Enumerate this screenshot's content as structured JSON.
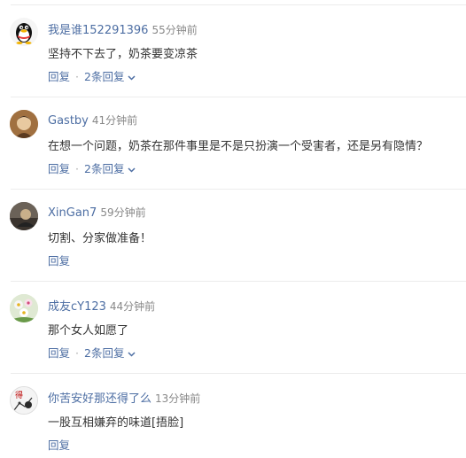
{
  "comments": [
    {
      "user": "我是谁152291396",
      "time": "55分钟前",
      "text": "坚持不下去了，奶茶要变凉茶",
      "reply_label": "回复",
      "replies_label": "2条回复",
      "avatar": "qq-penguin-icon"
    },
    {
      "user": "Gastby",
      "time": "41分钟前",
      "text": "在想一个问题，奶茶在那件事里是不是只扮演一个受害者，还是另有隐情？",
      "reply_label": "回复",
      "replies_label": "2条回复",
      "avatar": "photo-avatar"
    },
    {
      "user": "XinGan7",
      "time": "59分钟前",
      "text": "切割、分家做准备！",
      "reply_label": "回复",
      "avatar": "photo-avatar"
    },
    {
      "user": "成友cY123",
      "time": "44分钟前",
      "text": "那个女人如愿了",
      "reply_label": "回复",
      "replies_label": "2条回复",
      "avatar": "flowers-avatar"
    },
    {
      "user": "你苦安好那还得了么",
      "time": "13分钟前",
      "text": "一股互相嫌弃的味道[捂脸]",
      "reply_label": "回复",
      "avatar": "sketch-avatar",
      "avatar_text": "得"
    }
  ],
  "colors": {
    "link": "#4d6ea3",
    "meta": "#888888",
    "text": "#333333",
    "divider": "#ececec"
  }
}
